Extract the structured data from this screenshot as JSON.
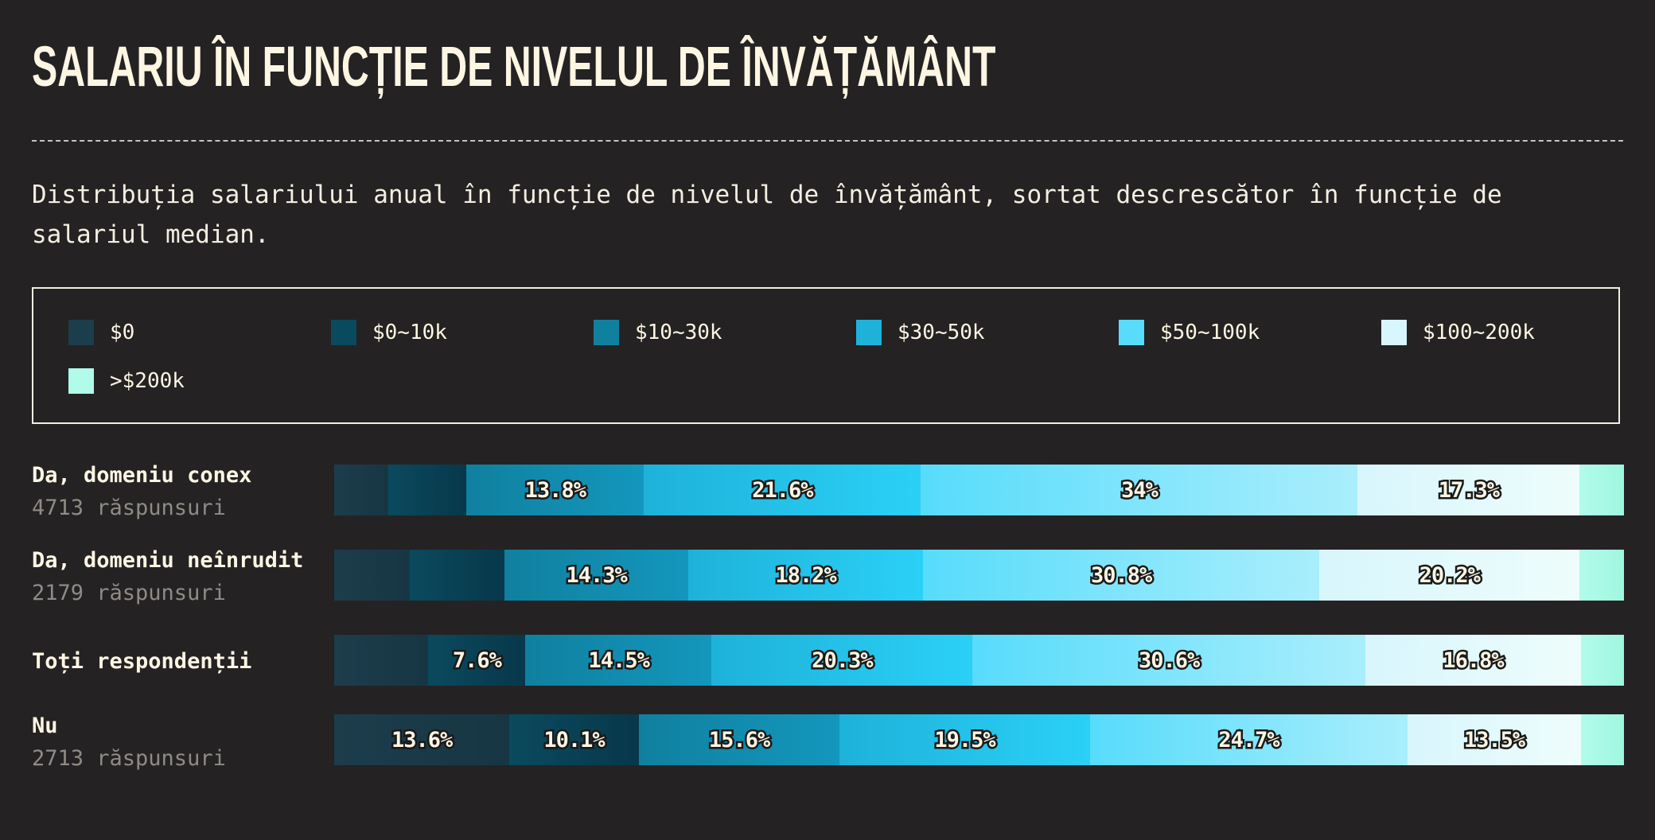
{
  "title": "SALARIU ÎN FUNCȚIE DE NIVELUL DE ÎNVĂȚĂMÂNT",
  "subtitle": "Distribuția salariului anual în funcție de nivelul de învățământ, sortat descrescător în funcție de salariul median.",
  "legend": [
    {
      "label": "$0",
      "color": "#1c3d4b"
    },
    {
      "label": "$0~10k",
      "color": "#0a4a5e"
    },
    {
      "label": "$10~30k",
      "color": "#10809f"
    },
    {
      "label": "$30~50k",
      "color": "#1eb2d9"
    },
    {
      "label": "$50~100k",
      "color": "#57dcfb"
    },
    {
      "label": "$100~200k",
      "color": "#d8f6fd"
    },
    {
      "label": ">$200k",
      "color": "#b2fbeb"
    }
  ],
  "chart_data": {
    "type": "bar",
    "orientation": "horizontal",
    "stacked": true,
    "normalized": true,
    "unit": "%",
    "title": "SALARIU ÎN FUNCȚIE DE NIVELUL DE ÎNVĂȚĂMÂNT",
    "subtitle": "Distribuția salariului anual în funcție de nivelul de învățământ, sortat descrescător în funcție de salariul median.",
    "legend_position": "top",
    "series_names": [
      "$0",
      "$0~10k",
      "$10~30k",
      "$30~50k",
      "$50~100k",
      "$100~200k",
      ">$200k"
    ],
    "rows": [
      {
        "name": "Da, domeniu conex",
        "count_label": "4713 răspunsuri",
        "values": [
          4.2,
          6.1,
          13.8,
          21.6,
          34,
          17.3,
          3.4
        ],
        "labels": [
          "",
          "",
          "13.8%",
          "21.6%",
          "34%",
          "17.3%",
          ""
        ]
      },
      {
        "name": "Da, domeniu neînrudit",
        "count_label": "2179 răspunsuri",
        "values": [
          5.9,
          7.3,
          14.3,
          18.2,
          30.8,
          20.2,
          3.4
        ],
        "labels": [
          "",
          "",
          "14.3%",
          "18.2%",
          "30.8%",
          "20.2%",
          ""
        ]
      },
      {
        "name": "Toți respondenții",
        "count_label": "",
        "values": [
          7.3,
          7.6,
          14.5,
          20.3,
          30.6,
          16.8,
          3.3
        ],
        "labels": [
          "",
          "7.6%",
          "14.5%",
          "20.3%",
          "30.6%",
          "16.8%",
          ""
        ]
      },
      {
        "name": "Nu",
        "count_label": "2713 răspunsuri",
        "values": [
          13.6,
          10.1,
          15.6,
          19.5,
          24.7,
          13.5,
          3.3
        ],
        "labels": [
          "13.6%",
          "10.1%",
          "15.6%",
          "19.5%",
          "24.7%",
          "13.5%",
          ""
        ]
      }
    ]
  }
}
